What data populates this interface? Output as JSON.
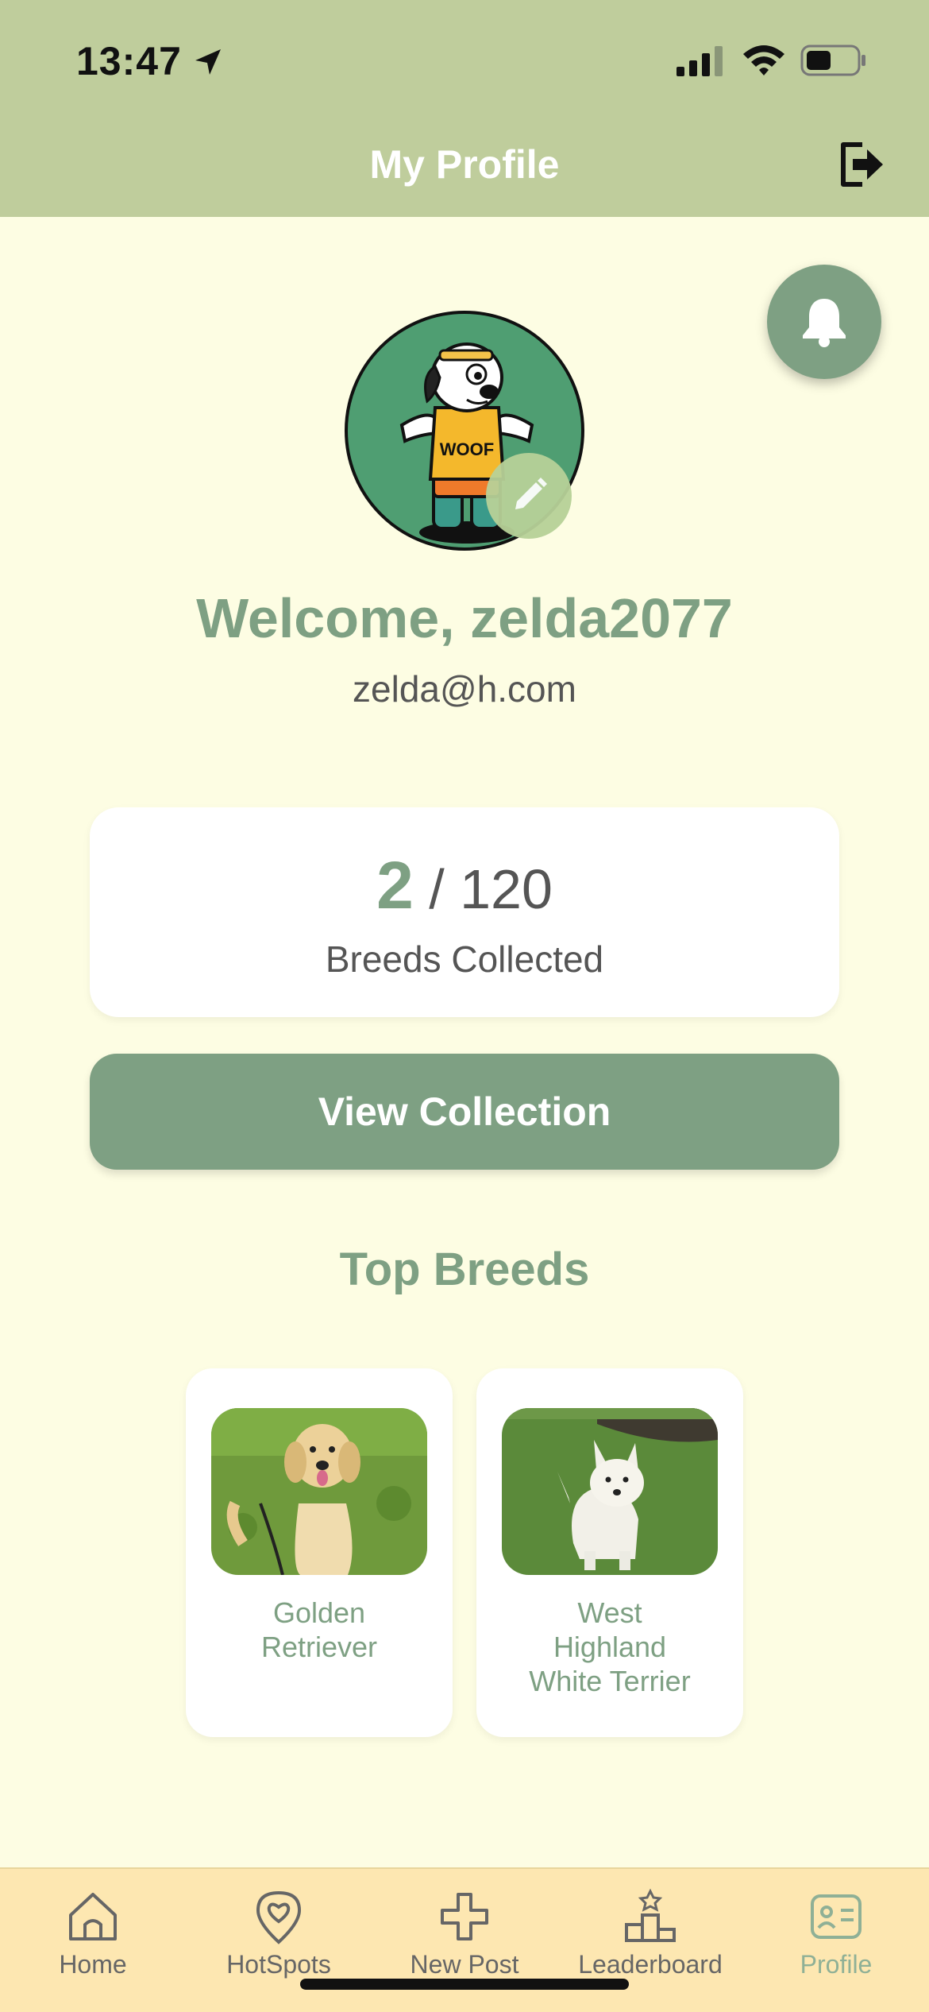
{
  "status_bar": {
    "time": "13:47"
  },
  "header": {
    "title": "My Profile"
  },
  "profile": {
    "avatar_text": "WOOF",
    "welcome": "Welcome, zelda2077",
    "email": "zelda@h.com"
  },
  "stats": {
    "collected": "2",
    "separator_total": "/ 120",
    "label": "Breeds Collected"
  },
  "view_collection_label": "View Collection",
  "top_breeds": {
    "title": "Top Breeds",
    "items": [
      {
        "name_lines": [
          "Golden",
          "Retriever"
        ]
      },
      {
        "name_lines": [
          "West",
          "Highland",
          "White Terrier"
        ]
      }
    ]
  },
  "tabs": [
    {
      "label": "Home",
      "icon": "home-icon"
    },
    {
      "label": "HotSpots",
      "icon": "heart-pin-icon"
    },
    {
      "label": "New Post",
      "icon": "plus-icon"
    },
    {
      "label": "Leaderboard",
      "icon": "podium-icon"
    },
    {
      "label": "Profile",
      "icon": "id-card-icon"
    }
  ],
  "colors": {
    "header": "#bfcd9c",
    "background": "#fdfde3",
    "accent": "#7ea083",
    "tabbar": "#fde7b1"
  }
}
